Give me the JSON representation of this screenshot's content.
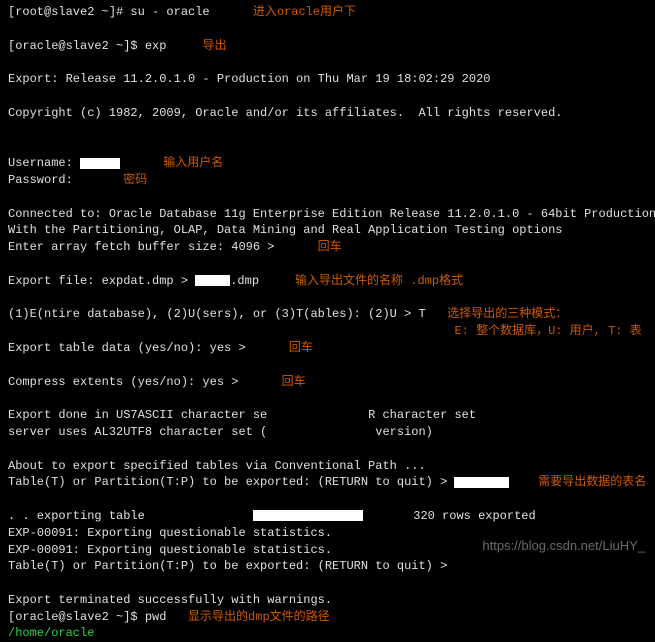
{
  "l1_prompt": "[root@slave2 ~]# ",
  "l1_cmd": "su - oracle",
  "l1_annot": "      进入oracle用户下",
  "l2_black": " ",
  "l3_prompt": "[oracle@slave2 ~]$ ",
  "l3_cmd": "exp",
  "l3_annot": "     导出",
  "l4": " ",
  "l5": "Export: Release 11.2.0.1.0 - Production on Thu Mar 19 18:02:29 2020",
  "l6": " ",
  "l7": "Copyright (c) 1982, 2009, Oracle and/or its affiliates.  All rights reserved.",
  "l8": " ",
  "l9": " ",
  "l10a": "Username: ",
  "l10_annot": "      输入用户名",
  "l11a": "Password:",
  "l11_annot": "       密码",
  "l12": " ",
  "l13": "Connected to: Oracle Database 11g Enterprise Edition Release 11.2.0.1.0 - 64bit Production",
  "l14": "With the Partitioning, OLAP, Data Mining and Real Application Testing options",
  "l15a": "Enter array fetch buffer size: 4096 > ",
  "l15_annot": "     回车",
  "l16": " ",
  "l17a": "Export file: expdat.dmp > ",
  "l17b": ".dmp",
  "l17_annot": "     输入导出文件的名称 .dmp格式",
  "l18": " ",
  "l19a": "(1)E(ntire database), (2)U(sers), or (3)T(ables): (2)U > T",
  "l19_annot": "   选择导出的三种模式：",
  "l19_annot2": "                                                              E: 整个数据库，U: 用户, T: 表",
  "l20a": "Export table data (yes/no): yes > ",
  "l20_annot": "     回车",
  "l21": " ",
  "l22a": "Compress extents (yes/no): yes > ",
  "l22_annot": "     回车",
  "l23": " ",
  "l24a": "Export done in US7ASCII character se",
  "l24b": "              R character set",
  "l25a": "server uses AL32UTF8 character set (",
  "l25b": "               version)",
  "l26": " ",
  "l27": "About to export specified tables via Conventional Path ...",
  "l28a": "Table(T) or Partition(T:P) to be exported: (RETURN to quit) > ",
  "l28_annot": "    需要导出数据的表名",
  "l29": " ",
  "l30a": ". . exporting table               ",
  "l30b": "       320 rows exported",
  "l31": "EXP-00091: Exporting questionable statistics.",
  "l32": "EXP-00091: Exporting questionable statistics.",
  "l33": "Table(T) or Partition(T:P) to be exported: (RETURN to quit) > ",
  "l34": " ",
  "l35": "Export terminated successfully with warnings.",
  "l36_prompt": "[oracle@slave2 ~]$ ",
  "l36_cmd": "pwd",
  "l36_annot": "   显示导出的dmp文件的路径",
  "l37": "/home/oracle",
  "watermark": "https://blog.csdn.net/LiuHY_"
}
